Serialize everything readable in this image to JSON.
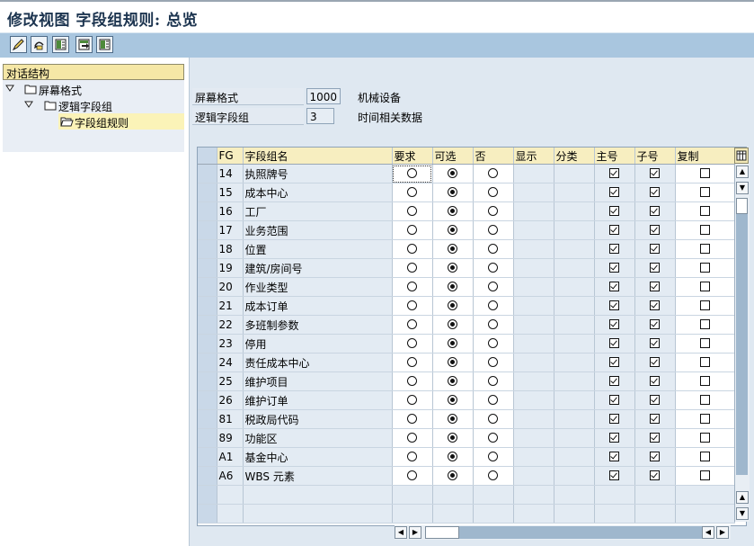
{
  "window": {
    "title": "修改视图 字段组规则: 总览"
  },
  "toolbar": {
    "buttons": [
      {
        "icon": "edit-pen-icon"
      },
      {
        "icon": "undo-display-icon"
      },
      {
        "icon": "table-first-icon"
      },
      {
        "icon": "table-export-icon"
      },
      {
        "icon": "table-last-icon"
      }
    ]
  },
  "tree": {
    "header": "对话结构",
    "nodes": [
      {
        "label": "屏幕格式",
        "level": 0,
        "expanded": true
      },
      {
        "label": "逻辑字段组",
        "level": 1,
        "expanded": true
      },
      {
        "label": "字段组规则",
        "level": 2,
        "selected": true
      }
    ]
  },
  "header": {
    "screen_format_label": "屏幕格式",
    "screen_format_value": "1000",
    "screen_format_desc": "机械设备",
    "logical_group_label": "逻辑字段组",
    "logical_group_value": "3",
    "logical_group_desc": "时间相关数据"
  },
  "table": {
    "columns": [
      "FG",
      "字段组名",
      "要求",
      "可选",
      "否",
      "显示",
      "分类",
      "主号",
      "子号",
      "复制"
    ],
    "rows": [
      {
        "fg": "14",
        "name": "执照牌号",
        "choice": "optional",
        "main": true,
        "sub": true,
        "copy": false
      },
      {
        "fg": "15",
        "name": "成本中心",
        "choice": "optional",
        "main": true,
        "sub": true,
        "copy": false
      },
      {
        "fg": "16",
        "name": "工厂",
        "choice": "optional",
        "main": true,
        "sub": true,
        "copy": false
      },
      {
        "fg": "17",
        "name": "业务范围",
        "choice": "optional",
        "main": true,
        "sub": true,
        "copy": false
      },
      {
        "fg": "18",
        "name": "位置",
        "choice": "optional",
        "main": true,
        "sub": true,
        "copy": false
      },
      {
        "fg": "19",
        "name": "建筑/房间号",
        "choice": "optional",
        "main": true,
        "sub": true,
        "copy": false
      },
      {
        "fg": "20",
        "name": "作业类型",
        "choice": "optional",
        "main": true,
        "sub": true,
        "copy": false
      },
      {
        "fg": "21",
        "name": "成本订单",
        "choice": "optional",
        "main": true,
        "sub": true,
        "copy": false
      },
      {
        "fg": "22",
        "name": "多班制参数",
        "choice": "optional",
        "main": true,
        "sub": true,
        "copy": false
      },
      {
        "fg": "23",
        "name": "停用",
        "choice": "optional",
        "main": true,
        "sub": true,
        "copy": false
      },
      {
        "fg": "24",
        "name": "责任成本中心",
        "choice": "optional",
        "main": true,
        "sub": true,
        "copy": false
      },
      {
        "fg": "25",
        "name": "维护项目",
        "choice": "optional",
        "main": true,
        "sub": true,
        "copy": false
      },
      {
        "fg": "26",
        "name": "维护订单",
        "choice": "optional",
        "main": true,
        "sub": true,
        "copy": false
      },
      {
        "fg": "81",
        "name": "税政局代码",
        "choice": "optional",
        "main": true,
        "sub": true,
        "copy": false
      },
      {
        "fg": "89",
        "name": "功能区",
        "choice": "optional",
        "main": true,
        "sub": true,
        "copy": false
      },
      {
        "fg": "A1",
        "name": "基金中心",
        "choice": "optional",
        "main": true,
        "sub": true,
        "copy": false
      },
      {
        "fg": "A6",
        "name": "WBS 元素",
        "choice": "optional",
        "main": true,
        "sub": true,
        "copy": false
      }
    ],
    "empty_rows": 2
  },
  "colors": {
    "toolbar_bg": "#a9c6df",
    "panel_bg": "#dfe8f1",
    "header_cell_bg": "#f7eec0",
    "title_color": "#1d3550"
  }
}
